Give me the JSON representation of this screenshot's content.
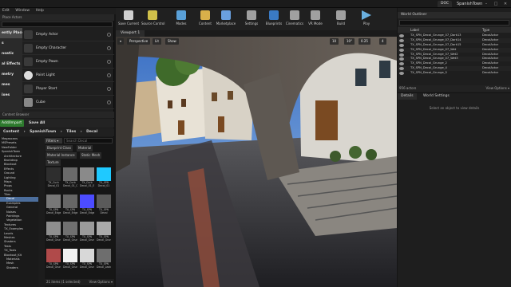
{
  "window": {
    "doc_tab": "DOC",
    "project_name": "SpanishTown"
  },
  "menu": [
    "Edit",
    "Window",
    "Help"
  ],
  "modes": {
    "header": "Place Actors",
    "categories": [
      "ently Placed",
      "s",
      "nsatic",
      "al Effects",
      "metry",
      "mes",
      "ixes"
    ],
    "actors": [
      "Empty Actor",
      "Empty Character",
      "Empty Pawn",
      "Point Light",
      "Player Start",
      "Cube"
    ]
  },
  "content_browser": {
    "header": "Content Browser",
    "add_import": "Add/Import ▾",
    "save_all": "Save All",
    "path": [
      "Content",
      "SpanishTown",
      "Tiles",
      "Decal"
    ],
    "tree": [
      "Megascans",
      "MSPresets",
      "NewFolder",
      "SpanishTown",
      "Architecture",
      "Backdrop",
      "Blockout",
      "Effects",
      "Ground",
      "Lighting",
      "Maps",
      "Props",
      "Rocks",
      "Tiles",
      "Decal",
      "Examples",
      "General",
      "Noises",
      "Paintings",
      "Vegetation",
      "Textures",
      "TX_Examples",
      "Levels",
      "Meshes",
      "Shaders",
      "Tests",
      "TX_Tools",
      "Blockout_Kit",
      "Materials",
      "Mesh",
      "Shaders"
    ],
    "filters": "Filters ▾",
    "search_placeholder": "Search Decal",
    "filter_tags": [
      "Blueprint Class",
      "Material",
      "Material Instance",
      "Static Mesh",
      "Texture"
    ],
    "thumbs": [
      "TX_Curb Decal_01",
      "TX_Curb Decal_01_Curb",
      "TX_Curb Decal_01_Edge",
      "TX_SPN Decal_01",
      "TX_SPN Decal_Edge",
      "TX_SPN Decal_Edge_01",
      "TX_SPN Decal_Edge_02",
      "TX_SPN Decal",
      "TX_SPN Decal_Grunge_01",
      "TX_SPN Decal_Grunge_02",
      "TX_SPN Decal_Grunge_03",
      "TX_SPN Decal_Grunge_04",
      "TX_SPN Decal_Grunge_05",
      "TX_SPN Decal_Grunge_06",
      "TX_SPN Decal_Grunge_07",
      "TX_SPN Decal_Leak"
    ],
    "items_count": "21 items (1 selected)",
    "view_options": "View Options ▾"
  },
  "toolbar": [
    "Save Current",
    "Source Control",
    "Modes",
    "Content",
    "Marketplace",
    "Settings",
    "Blueprints",
    "Cinematics",
    "VR Mode",
    "Build",
    "Play"
  ],
  "viewport": {
    "tab": "Viewport 1",
    "buttons": [
      "Perspective",
      "Lit",
      "Show"
    ],
    "snap": [
      "10",
      "10°",
      "0.25",
      "4"
    ]
  },
  "outliner": {
    "header": "World Outliner",
    "col_label": "Label",
    "col_type": "Type",
    "rows": [
      {
        "label": "TX_SPN_Decal_Grunge_07_Dark13",
        "type": "DecalActor"
      },
      {
        "label": "TX_SPN_Decal_Grunge_07_Dark14",
        "type": "DecalActor"
      },
      {
        "label": "TX_SPN_Decal_Grunge_07_Dark15",
        "type": "DecalActor"
      },
      {
        "label": "TX_SPN_Decal_Grunge_07_Wet",
        "type": "DecalActor"
      },
      {
        "label": "TX_SPN_Decal_Grunge_07_Wet2",
        "type": "DecalActor"
      },
      {
        "label": "TX_SPN_Decal_Grunge_07_Wet3",
        "type": "DecalActor"
      },
      {
        "label": "TX_SPN_Decal_Grunge_2",
        "type": "DecalActor"
      },
      {
        "label": "TX_SPN_Decal_Grunge_4",
        "type": "DecalActor"
      },
      {
        "label": "TX_SPN_Decal_Grunge_5",
        "type": "DecalActor"
      }
    ],
    "actor_count": "956 actors",
    "view_options": "View Options ▾"
  },
  "details": {
    "tab_details": "Details",
    "tab_world": "World Settings",
    "empty_message": "Select an object to view details"
  }
}
